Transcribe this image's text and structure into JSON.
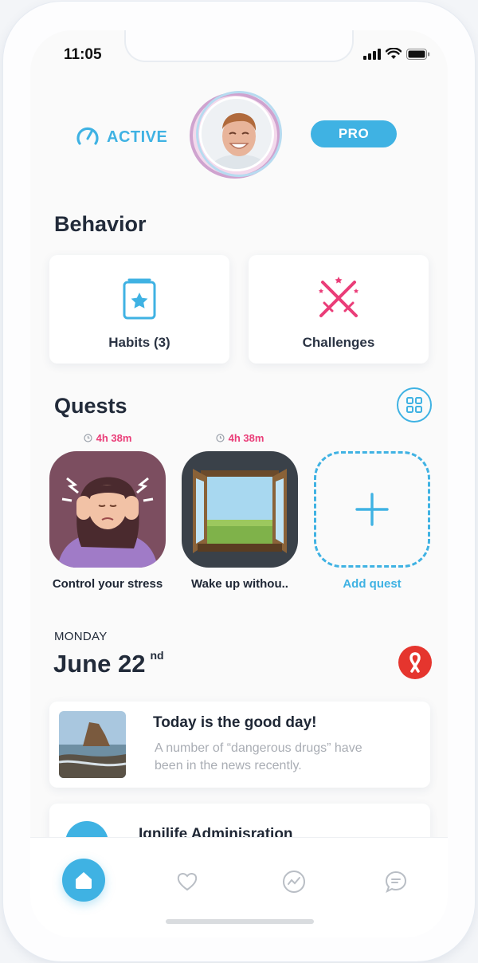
{
  "status_bar": {
    "time": "11:05"
  },
  "header": {
    "status_label": "ACTIVE",
    "pro_label": "PRO",
    "accent_color": "#3fb2e3"
  },
  "behavior": {
    "title": "Behavior",
    "cards": [
      {
        "label": "Habits (3)",
        "icon": "star-card-icon"
      },
      {
        "label": "Challenges",
        "icon": "crossed-swords-icon"
      }
    ]
  },
  "quests": {
    "title": "Quests",
    "items": [
      {
        "timer": "4h 38m",
        "name": "Control your stress",
        "icon": "stressed-woman-illustration"
      },
      {
        "timer": "4h 38m",
        "name": "Wake up withou..",
        "icon": "open-window-illustration"
      }
    ],
    "add_label": "Add quest",
    "timer_color": "#ea3d78"
  },
  "date": {
    "day": "MONDAY",
    "date": "June 22",
    "suffix": "nd"
  },
  "news": {
    "title": "Today is the good day!",
    "body": "A number of “dangerous drugs” have been in the news recently."
  },
  "admin": {
    "title": "Ignilife Adminisration"
  },
  "tabs": [
    {
      "name": "home",
      "icon": "home-icon"
    },
    {
      "name": "favorites",
      "icon": "heart-icon"
    },
    {
      "name": "activity",
      "icon": "chart-icon"
    },
    {
      "name": "messages",
      "icon": "chat-icon"
    }
  ]
}
